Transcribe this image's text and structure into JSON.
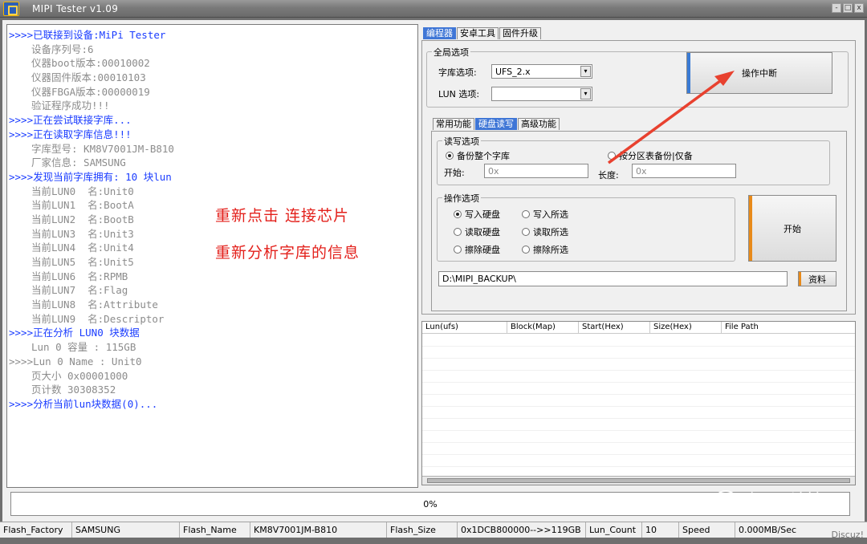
{
  "window": {
    "title": "MIPI Tester v1.09",
    "buttons": [
      "-",
      "□",
      "x"
    ]
  },
  "log": {
    "lines": [
      {
        "type": "head",
        "text": ">>>>已联接到设备:MiPi Tester"
      },
      {
        "type": "sub",
        "text": "设备序列号:6"
      },
      {
        "type": "sub",
        "text": "仪器boot版本:00010002"
      },
      {
        "type": "sub",
        "text": "仪器固件版本:00010103"
      },
      {
        "type": "sub",
        "text": "仪器FBGA版本:00000019"
      },
      {
        "type": "sub",
        "text": "验证程序成功!!!"
      },
      {
        "type": "head",
        "text": ">>>>正在尝试联接字库..."
      },
      {
        "type": "head",
        "text": ">>>>正在读取字库信息!!!"
      },
      {
        "type": "sub",
        "text": "字库型号: KM8V7001JM-B810"
      },
      {
        "type": "sub",
        "text": "厂家信息: SAMSUNG"
      },
      {
        "type": "head",
        "text": ">>>>发现当前字库拥有: 10 块lun"
      },
      {
        "type": "sub",
        "text": "当前LUN0  名:Unit0"
      },
      {
        "type": "sub",
        "text": "当前LUN1  名:BootA"
      },
      {
        "type": "sub",
        "text": "当前LUN2  名:BootB"
      },
      {
        "type": "sub",
        "text": "当前LUN3  名:Unit3"
      },
      {
        "type": "sub",
        "text": "当前LUN4  名:Unit4"
      },
      {
        "type": "sub",
        "text": "当前LUN5  名:Unit5"
      },
      {
        "type": "sub",
        "text": "当前LUN6  名:RPMB"
      },
      {
        "type": "sub",
        "text": "当前LUN7  名:Flag"
      },
      {
        "type": "sub",
        "text": "当前LUN8  名:Attribute"
      },
      {
        "type": "sub",
        "text": "当前LUN9  名:Descriptor"
      },
      {
        "type": "head",
        "text": ">>>>正在分析 LUN0 块数据"
      },
      {
        "type": "sub",
        "text": "Lun 0 容量 : 115GB"
      },
      {
        "type": "plain",
        "text": ">>>>Lun 0 Name : Unit0"
      },
      {
        "type": "sub",
        "text": "页大小 0x00001000"
      },
      {
        "type": "sub",
        "text": "页计数 30308352"
      },
      {
        "type": "head",
        "text": ">>>>分析当前lun块数据(0)..."
      }
    ]
  },
  "annotations": {
    "line1": "重新点击 连接芯片",
    "line2": "重新分析字库的信息",
    "arrow_color": "#e8412f"
  },
  "main_tabs": [
    "编程器",
    "安卓工具",
    "固件升级"
  ],
  "global_options": {
    "title": "全局选项",
    "font_lib_label": "字库选项:",
    "font_lib_value": "UFS_2.x",
    "lun_label": "LUN 选项:",
    "lun_value": "",
    "abort_button": "操作中断"
  },
  "sub_tabs": [
    "常用功能",
    "硬盘读写",
    "高级功能"
  ],
  "rw_options": {
    "title": "读写选项",
    "backup_all": "备份整个字库",
    "backup_partition": "按分区表备份|仅备",
    "start_label": "开始:",
    "start_placeholder": "0x",
    "length_label": "长度:",
    "length_placeholder": "0x"
  },
  "op_options": {
    "title": "操作选项",
    "items": [
      "写入硬盘",
      "写入所选",
      "读取硬盘",
      "读取所选",
      "擦除硬盘",
      "擦除所选"
    ],
    "start_button": "开始"
  },
  "path": {
    "value": "D:\\MIPI_BACKUP\\",
    "browse_button": "资料"
  },
  "file_table": {
    "columns": [
      "Lun(ufs)",
      "Block(Map)",
      "Start(Hex)",
      "Size(Hex)",
      "File Path"
    ]
  },
  "progress": {
    "value": 0,
    "text": "0%",
    "accent": "#3cb043"
  },
  "watermark": "恒熙科技",
  "status_bar": [
    {
      "label": "Flash_Factory",
      "value": "SAMSUNG"
    },
    {
      "label": "Flash_Name",
      "value": "KM8V7001JM-B810"
    },
    {
      "label": "Flash_Size",
      "value": "0x1DCB800000-->>119GB"
    },
    {
      "label": "Lun_Count",
      "value": "10"
    },
    {
      "label": "Speed",
      "value": "0.000MB/Sec"
    }
  ],
  "discuz": "Discuz!"
}
